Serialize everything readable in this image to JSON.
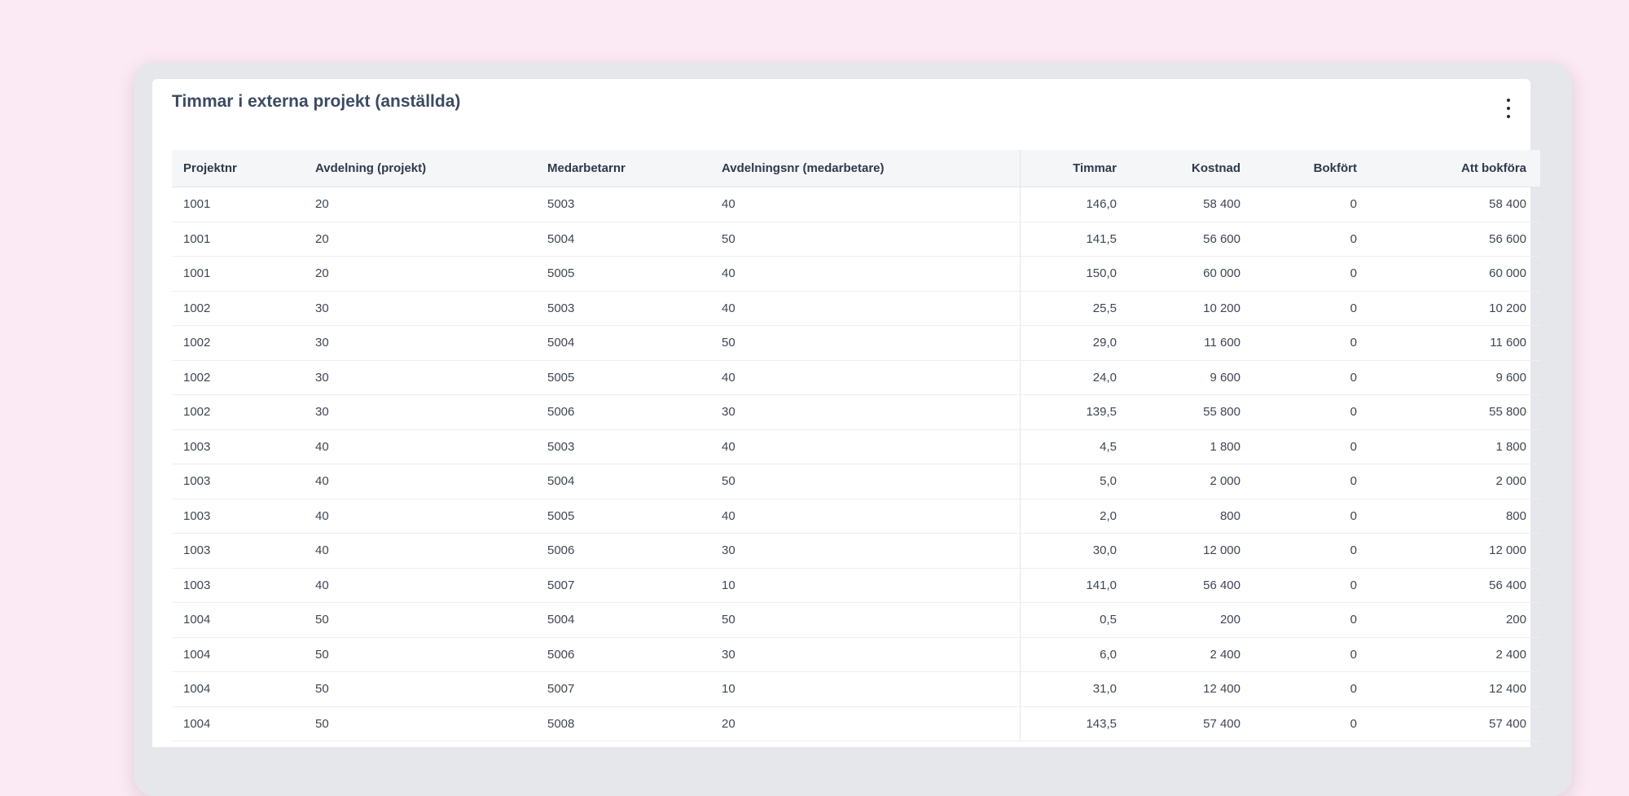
{
  "card": {
    "title": "Timmar i externa projekt (anställda)",
    "menu_icon": "more-vertical-icon"
  },
  "table": {
    "columns": [
      "Projektnr",
      "Avdelning (projekt)",
      "Medarbetarnr",
      "Avdelningsnr (medarbetare)",
      "Timmar",
      "Kostnad",
      "Bokfört",
      "Att bokföra"
    ],
    "rows": [
      [
        "1001",
        "20",
        "5003",
        "40",
        "146,0",
        "58 400",
        "0",
        "58 400"
      ],
      [
        "1001",
        "20",
        "5004",
        "50",
        "141,5",
        "56 600",
        "0",
        "56 600"
      ],
      [
        "1001",
        "20",
        "5005",
        "40",
        "150,0",
        "60 000",
        "0",
        "60 000"
      ],
      [
        "1002",
        "30",
        "5003",
        "40",
        "25,5",
        "10 200",
        "0",
        "10 200"
      ],
      [
        "1002",
        "30",
        "5004",
        "50",
        "29,0",
        "11 600",
        "0",
        "11 600"
      ],
      [
        "1002",
        "30",
        "5005",
        "40",
        "24,0",
        "9 600",
        "0",
        "9 600"
      ],
      [
        "1002",
        "30",
        "5006",
        "30",
        "139,5",
        "55 800",
        "0",
        "55 800"
      ],
      [
        "1003",
        "40",
        "5003",
        "40",
        "4,5",
        "1 800",
        "0",
        "1 800"
      ],
      [
        "1003",
        "40",
        "5004",
        "50",
        "5,0",
        "2 000",
        "0",
        "2 000"
      ],
      [
        "1003",
        "40",
        "5005",
        "40",
        "2,0",
        "800",
        "0",
        "800"
      ],
      [
        "1003",
        "40",
        "5006",
        "30",
        "30,0",
        "12 000",
        "0",
        "12 000"
      ],
      [
        "1003",
        "40",
        "5007",
        "10",
        "141,0",
        "56 400",
        "0",
        "56 400"
      ],
      [
        "1004",
        "50",
        "5004",
        "50",
        "0,5",
        "200",
        "0",
        "200"
      ],
      [
        "1004",
        "50",
        "5006",
        "30",
        "6,0",
        "2 400",
        "0",
        "2 400"
      ],
      [
        "1004",
        "50",
        "5007",
        "10",
        "31,0",
        "12 400",
        "0",
        "12 400"
      ],
      [
        "1004",
        "50",
        "5008",
        "20",
        "143,5",
        "57 400",
        "0",
        "57 400"
      ]
    ]
  }
}
